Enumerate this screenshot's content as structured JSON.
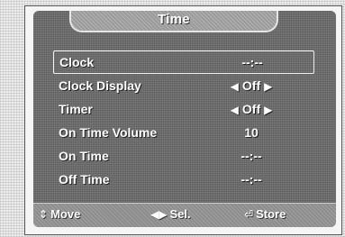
{
  "menu": {
    "title": "Time",
    "items": [
      {
        "label": "Clock",
        "value": "--:--",
        "left_arrow": "",
        "right_arrow": "",
        "selected": true
      },
      {
        "label": "Clock Display",
        "value": "Off",
        "left_arrow": "◀",
        "right_arrow": "▶",
        "selected": false
      },
      {
        "label": "Timer",
        "value": "Off",
        "left_arrow": "◀",
        "right_arrow": "▶",
        "selected": false
      },
      {
        "label": "On Time Volume",
        "value": "10",
        "left_arrow": "",
        "right_arrow": "",
        "selected": false
      },
      {
        "label": "On Time",
        "value": "--:--",
        "left_arrow": "",
        "right_arrow": "",
        "selected": false
      },
      {
        "label": "Off Time",
        "value": "--:--",
        "left_arrow": "",
        "right_arrow": "",
        "selected": false
      }
    ]
  },
  "footer": {
    "move": {
      "icon": "up-down-arrow-icon",
      "glyph": "⇕",
      "label": "Move"
    },
    "sel": {
      "icon": "left-right-arrow-icon",
      "glyph": "◀▶",
      "label": "Sel."
    },
    "store": {
      "icon": "enter-icon",
      "glyph": "⏎",
      "label": "Store"
    }
  }
}
